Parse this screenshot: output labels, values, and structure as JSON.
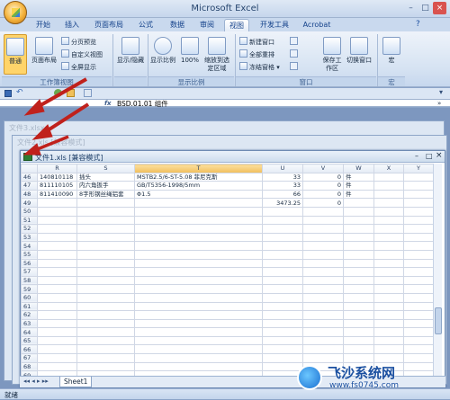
{
  "app": {
    "title": "Microsoft Excel",
    "window_controls": [
      "–",
      "□",
      "×"
    ]
  },
  "ribbon_tabs": [
    "开始",
    "插入",
    "页面布局",
    "公式",
    "数据",
    "审阅",
    "视图",
    "开发工具",
    "Acrobat"
  ],
  "active_tab": "视图",
  "ribbon": {
    "workbook_views": {
      "normal": "普通",
      "page_layout": "页面布局",
      "page_break_preview": "分页预览",
      "custom_views": "自定义视图",
      "full_screen": "全屏显示",
      "group_label": "工作簿视图"
    },
    "show_hide": {
      "label": "显示/隐藏"
    },
    "zoom": {
      "zoom": "显示比例",
      "hundred": "100%",
      "zoom_to_selection": "缩放到选定区域",
      "group_label": "显示比例"
    },
    "window": {
      "new_window": "新建窗口",
      "arrange_all": "全部重排",
      "freeze_panes": "冻结窗格",
      "save_workspace": "保存工作区",
      "switch_windows": "切换窗口",
      "group_label": "窗口"
    },
    "macros": {
      "label": "宏",
      "group_label": "宏"
    }
  },
  "formula_bar": {
    "fx": "fx",
    "value": "BSD.01.01 组件"
  },
  "background_windows": [
    "文件3.xlsx",
    "文件2.xls [兼容模式]"
  ],
  "sheet_window": {
    "title": "文件1.xls [兼容模式]",
    "columns": [
      "R",
      "S",
      "T",
      "U",
      "V",
      "W",
      "X",
      "Y"
    ],
    "rows": [
      {
        "row": "46",
        "R": "140810118",
        "S": "插头",
        "T": "MSTB2.5/6-ST-5.08 菲尼克斯",
        "U": "33",
        "V": "0",
        "W": "件"
      },
      {
        "row": "47",
        "R": "811110105",
        "S": "内六角扳手",
        "T": "GB/T5356-1998/5mm",
        "U": "33",
        "V": "0",
        "W": "件"
      },
      {
        "row": "48",
        "R": "811410090",
        "S": "8字形钢丝绳铝套",
        "T": "Φ1.5",
        "U": "66",
        "V": "0",
        "W": "件"
      },
      {
        "row": "49",
        "R": "",
        "S": "",
        "T": "",
        "U": "3473.25",
        "V": "0",
        "W": ""
      },
      {
        "row": "50"
      },
      {
        "row": "51"
      },
      {
        "row": "52"
      },
      {
        "row": "53"
      },
      {
        "row": "54"
      },
      {
        "row": "55"
      },
      {
        "row": "56"
      },
      {
        "row": "57"
      },
      {
        "row": "58"
      },
      {
        "row": "59"
      },
      {
        "row": "60"
      },
      {
        "row": "61"
      },
      {
        "row": "62"
      },
      {
        "row": "63"
      },
      {
        "row": "64"
      },
      {
        "row": "65"
      },
      {
        "row": "66"
      },
      {
        "row": "67"
      },
      {
        "row": "68"
      },
      {
        "row": "69"
      }
    ],
    "sheet_tab": "Sheet1"
  },
  "status": {
    "ready": "就绪"
  },
  "watermark": {
    "brand": "飞沙系统网",
    "url": "www.fs0745.com"
  }
}
